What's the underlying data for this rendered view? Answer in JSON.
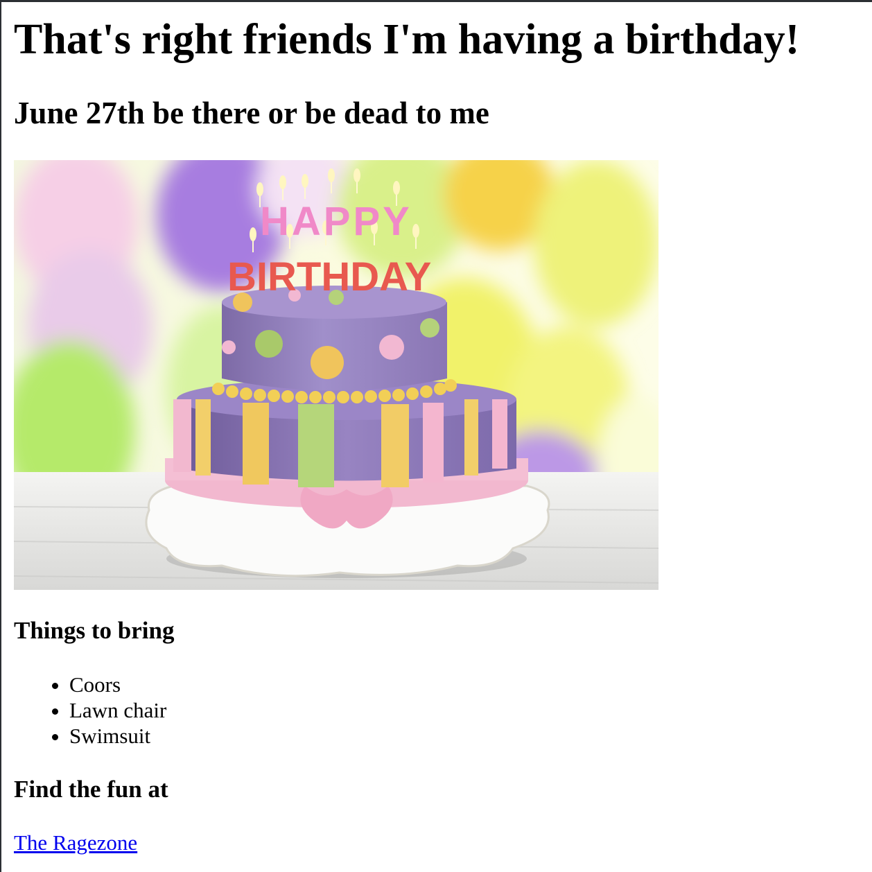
{
  "page": {
    "title": "That's right friends I'm having a birthday!",
    "subtitle": "June 27th be there or be dead to me",
    "bring_heading": "Things to bring",
    "bring_items": [
      "Coors",
      "Lawn chair",
      "Swimsuit"
    ],
    "location_heading": "Find the fun at",
    "location_link": "The Ragezone"
  },
  "image": {
    "line1": "HAPPY",
    "line2": "BIRTHDAY"
  }
}
